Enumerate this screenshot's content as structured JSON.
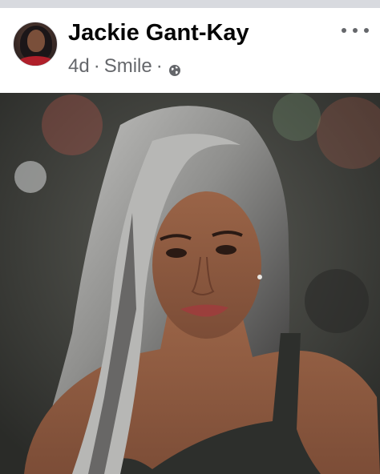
{
  "post": {
    "author_name": "Jackie Gant-Kay",
    "timestamp": "4d",
    "separator": "·",
    "feeling": "Smile",
    "privacy_icon": "globe-icon",
    "more_icon": "more-options-icon"
  },
  "colors": {
    "name_text": "#050505",
    "meta_text": "#65676b",
    "top_bar": "#d8dadf"
  }
}
